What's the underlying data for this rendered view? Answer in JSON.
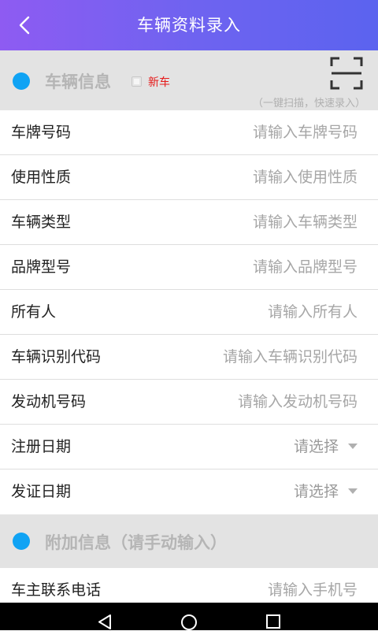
{
  "header": {
    "title": "车辆资料录入",
    "back_icon": "back-chevron-icon"
  },
  "vehicle_section": {
    "title": "车辆信息",
    "new_car_label": "新车",
    "new_car_checked": false,
    "scan_icon": "scan-frame-icon",
    "scan_hint": "（一键扫描，快速录入）",
    "dot_color": "#10a3f4"
  },
  "vehicle_fields": [
    {
      "label": "车牌号码",
      "placeholder": "请输入车牌号码"
    },
    {
      "label": "使用性质",
      "placeholder": "请输入使用性质"
    },
    {
      "label": "车辆类型",
      "placeholder": "请输入车辆类型"
    },
    {
      "label": "品牌型号",
      "placeholder": "请输入品牌型号"
    },
    {
      "label": "所有人",
      "placeholder": "请输入所有人"
    },
    {
      "label": "车辆识别代码",
      "placeholder": "请输入车辆识别代码"
    },
    {
      "label": "发动机号码",
      "placeholder": "请输入发动机号码"
    }
  ],
  "date_fields": [
    {
      "label": "注册日期",
      "value": "请选择"
    },
    {
      "label": "发证日期",
      "value": "请选择"
    }
  ],
  "extra_section": {
    "title": "附加信息（请手动输入）"
  },
  "extra_fields": [
    {
      "label": "车主联系电话",
      "placeholder": "请输入手机号"
    }
  ],
  "system_nav": {
    "back": "nav-back-icon",
    "home": "nav-home-icon",
    "recents": "nav-recents-icon"
  },
  "colors": {
    "header_start": "#8e5bf2",
    "header_end": "#5b63ef",
    "accent_red": "#e61a1a"
  }
}
